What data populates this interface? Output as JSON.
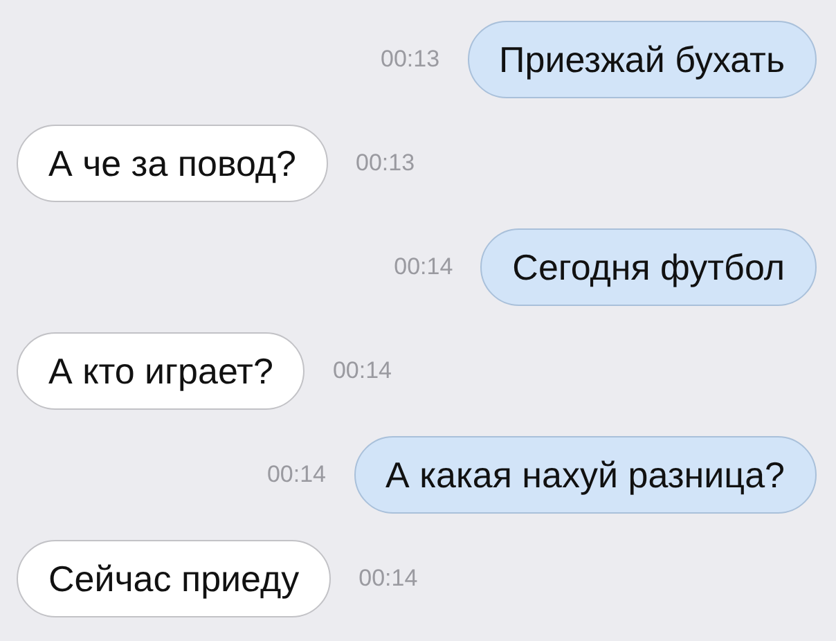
{
  "messages": [
    {
      "kind": "outgoing",
      "text": "Приезжай бухать",
      "time": "00:13"
    },
    {
      "kind": "incoming",
      "text": "А че за повод?",
      "time": "00:13"
    },
    {
      "kind": "outgoing",
      "text": "Сегодня футбол",
      "time": "00:14"
    },
    {
      "kind": "incoming",
      "text": "А кто играет?",
      "time": "00:14"
    },
    {
      "kind": "outgoing",
      "text": "А какая нахуй разница?",
      "time": "00:14"
    },
    {
      "kind": "incoming",
      "text": "Сейчас приеду",
      "time": "00:14"
    }
  ]
}
